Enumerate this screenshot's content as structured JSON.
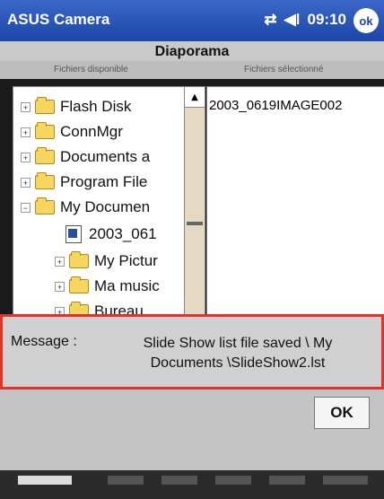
{
  "titlebar": {
    "app": "ASUS Camera",
    "time": "09:10",
    "ok": "ok"
  },
  "dialog": {
    "title": "Diaporama",
    "col_available": "Fichiers disponible",
    "col_selected": "Fichiers sélectionné"
  },
  "tree": [
    {
      "label": "Flash Disk",
      "expander": "+"
    },
    {
      "label": "ConnMgr",
      "expander": "+"
    },
    {
      "label": "Documents a",
      "expander": "+"
    },
    {
      "label": "Program File",
      "expander": "+"
    },
    {
      "label": "My Documen",
      "expander": "−"
    },
    {
      "label": "2003_061",
      "expander": ""
    },
    {
      "label": "My Pictur",
      "expander": "+"
    },
    {
      "label": "Ma music",
      "expander": "+"
    },
    {
      "label": "Bureau",
      "expander": "+"
    }
  ],
  "selected_files": [
    "2003_0619IMAGE002"
  ],
  "message": {
    "label": "Message :",
    "text": "Slide Show list file saved \\ My Documents \\SlideShow2.lst"
  },
  "ok_button": "OK"
}
